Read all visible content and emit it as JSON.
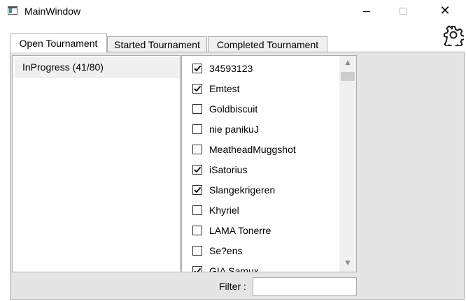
{
  "window": {
    "title": "MainWindow",
    "controls": {
      "minimize": "minimize-icon",
      "maximize": "maximize-icon",
      "close": "close-icon"
    }
  },
  "settings": {
    "icon": "gear-icon"
  },
  "tabs": [
    {
      "label": "Open Tournament",
      "active": true
    },
    {
      "label": "Started Tournament",
      "active": false
    },
    {
      "label": "Completed Tournament",
      "active": false
    }
  ],
  "left_panel": {
    "items": [
      {
        "label": "InProgress (41/80)"
      }
    ]
  },
  "players": [
    {
      "name": "34593123",
      "checked": true
    },
    {
      "name": "Emtest",
      "checked": true
    },
    {
      "name": "Goldbiscuit",
      "checked": false
    },
    {
      "name": "nie panikuJ",
      "checked": false
    },
    {
      "name": "MeatheadMuggshot",
      "checked": false
    },
    {
      "name": "iSatorius",
      "checked": true
    },
    {
      "name": "Slangekrigeren",
      "checked": true
    },
    {
      "name": "Khyriel",
      "checked": false
    },
    {
      "name": "LAMA Tonerre",
      "checked": false
    },
    {
      "name": "Se?ens",
      "checked": false
    },
    {
      "name": "GIA Samux",
      "checked": true
    }
  ],
  "filter": {
    "label": "Filter :",
    "value": ""
  },
  "colors": {
    "window_bg": "#ffffff",
    "panel_bg": "#e5e5e5",
    "item_bg": "#f0f0f0",
    "border": "#acacac"
  }
}
